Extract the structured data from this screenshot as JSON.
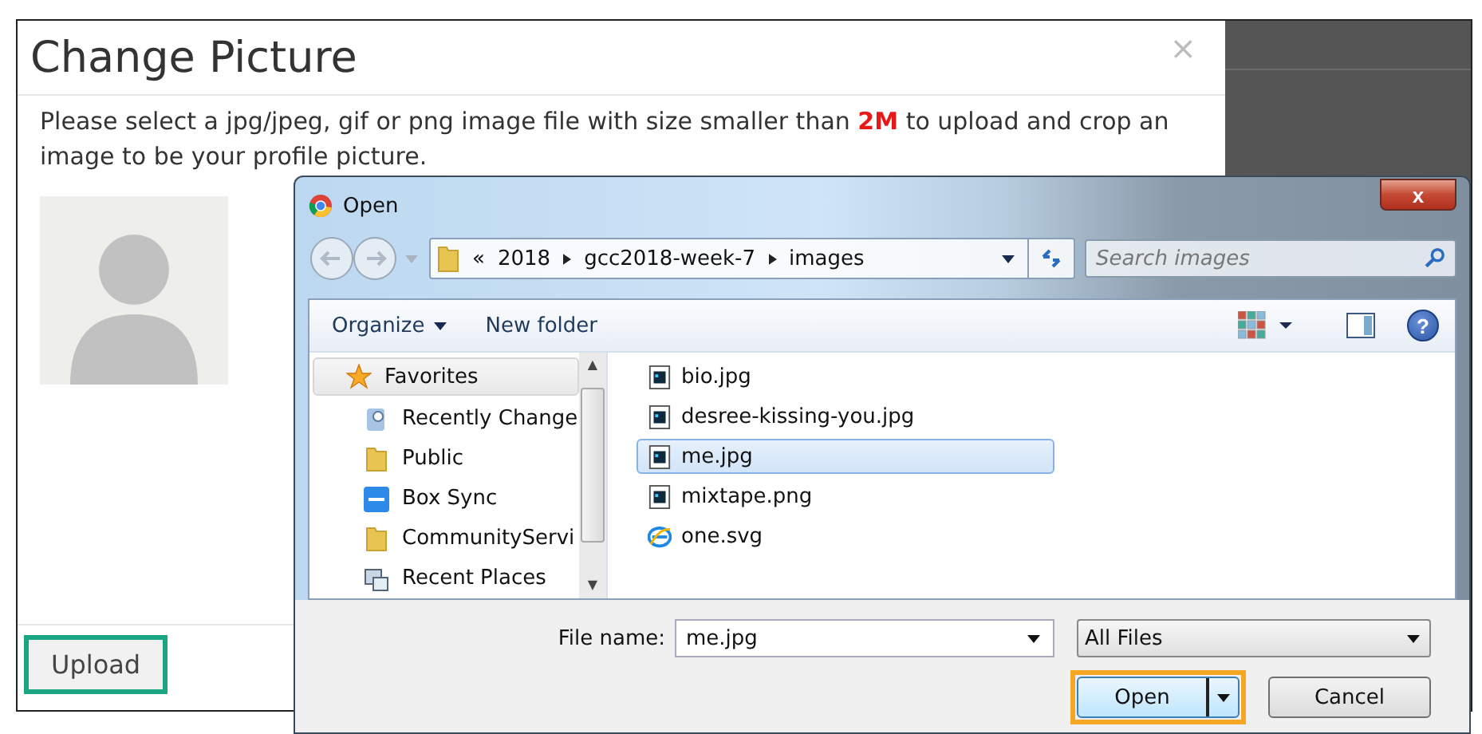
{
  "modal": {
    "title": "Change Picture",
    "close": "×",
    "message": "Please select a jpg/jpeg, gif or png image file with size smaller than **2M** to upload and crop an image to be your profile picture.",
    "upload_button": "Upload"
  },
  "dialog": {
    "title": "Open",
    "close": "x",
    "address": {
      "overflow": "«",
      "parts": [
        "2018",
        "gcc2018-week-7",
        "images"
      ]
    },
    "search": {
      "placeholder": "Search images"
    },
    "toolbar": {
      "organize": "Organize",
      "new_folder": "New folder",
      "help": "?"
    },
    "scroll": {
      "up": "▲",
      "down": "▼"
    },
    "nav": [
      {
        "label": "Favorites",
        "kind": "favorites"
      },
      {
        "label": "Recently Change",
        "kind": "recent"
      },
      {
        "label": "Public",
        "kind": "folder"
      },
      {
        "label": "Box Sync",
        "kind": "box"
      },
      {
        "label": "CommunityServi",
        "kind": "folder"
      },
      {
        "label": "Recent Places",
        "kind": "places"
      }
    ],
    "files": [
      {
        "name": "bio.jpg",
        "kind": "image",
        "selected": false
      },
      {
        "name": "desree-kissing-you.jpg",
        "kind": "image",
        "selected": false
      },
      {
        "name": "me.jpg",
        "kind": "image",
        "selected": true
      },
      {
        "name": "mixtape.png",
        "kind": "image",
        "selected": false
      },
      {
        "name": "one.svg",
        "kind": "web",
        "selected": false
      }
    ],
    "file_name": {
      "label": "File name:",
      "value": "me.jpg"
    },
    "file_type": "All Files",
    "open_button": "Open",
    "cancel_button": "Cancel"
  }
}
